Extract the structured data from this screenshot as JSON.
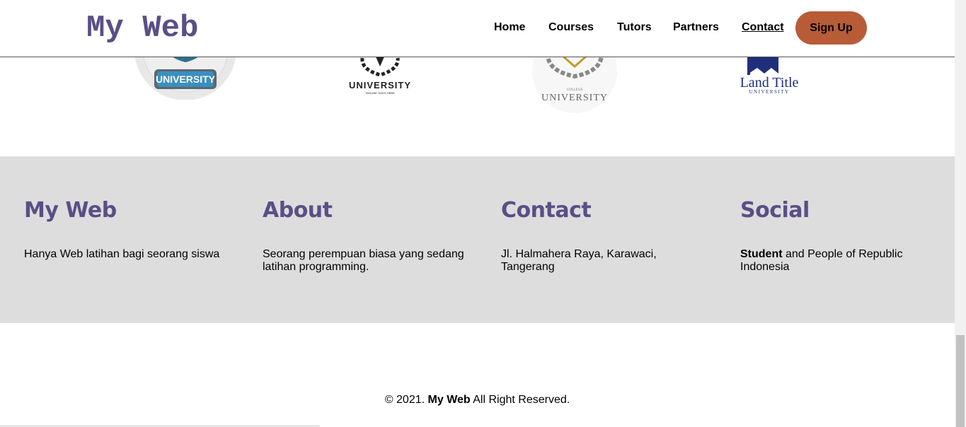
{
  "header": {
    "brand": "My Web",
    "nav": {
      "home": "Home",
      "courses": "Courses",
      "tutors": "Tutors",
      "partners": "Partners",
      "contact": "Contact",
      "signup": "Sign Up"
    }
  },
  "partners": {
    "logos": [
      {
        "text": "UNIVERSITY",
        "icon": "university-badge-logo"
      },
      {
        "text": "UNIVERSITY",
        "subtext": "TAGLINE GOES HERE",
        "icon": "laurel-crest-logo"
      },
      {
        "text": "UNIVERSITY",
        "subtext": "COLLEGE",
        "icon": "laurel-shield-logo"
      },
      {
        "text": "Land Title",
        "subtext": "UNIVERSITY",
        "icon": "land-title-logo"
      }
    ]
  },
  "footer": {
    "columns": [
      {
        "title": "My Web",
        "text": "Hanya Web latihan bagi seorang siswa"
      },
      {
        "title": "About",
        "text": "Seorang perempuan biasa yang sedang latihan programming."
      },
      {
        "title": "Contact",
        "text": "Jl. Halmahera Raya, Karawaci, Tangerang"
      },
      {
        "title": "Social",
        "text_bold": "Student",
        "text": " and People of Republic Indonesia"
      }
    ],
    "copyright_prefix": "© 2021. ",
    "copyright_brand": "My Web",
    "copyright_suffix": " All Right Reserved."
  },
  "colors": {
    "brand": "#5a4f86",
    "signup": "#b85c38",
    "band": "#dddddd"
  }
}
